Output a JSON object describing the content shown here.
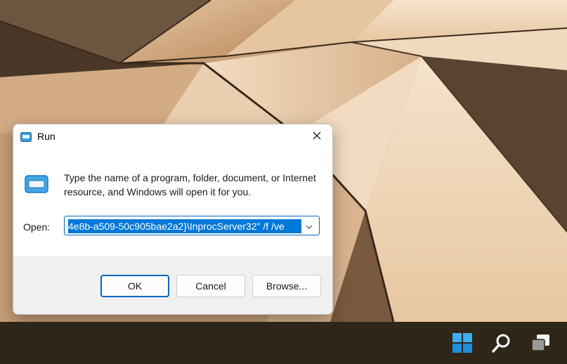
{
  "colors": {
    "accent": "#0067c0",
    "selection": "#0078d7",
    "taskbar": "#2f2519",
    "footer": "#f0f0f0"
  },
  "dialog": {
    "title": "Run",
    "title_icon": "run-icon",
    "close_icon": "close-icon",
    "description": "Type the name of a program, folder, document, or Internet resource, and Windows will open it for you.",
    "open_label": "Open:",
    "open_value": "4e8b-a509-50c905bae2a2}\\InprocServer32\" /f /ve",
    "dropdown_icon": "chevron-down-icon",
    "buttons": {
      "ok": "OK",
      "cancel": "Cancel",
      "browse": "Browse..."
    }
  },
  "taskbar": {
    "icons": [
      "windows-start-icon",
      "search-icon",
      "task-view-icon"
    ]
  }
}
